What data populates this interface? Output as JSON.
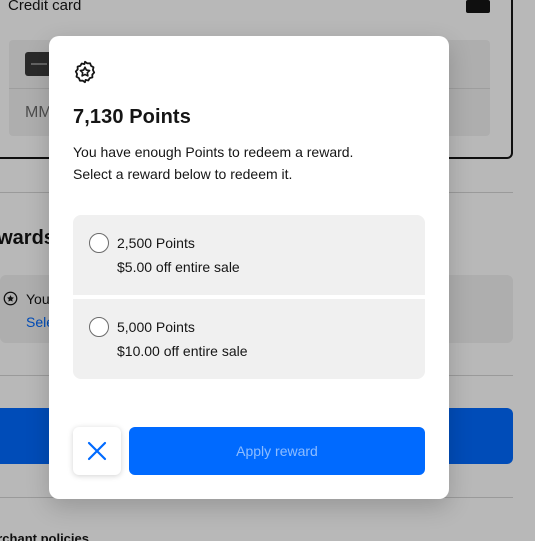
{
  "background": {
    "payment_label": "Credit card",
    "expiry_placeholder": "MM",
    "rewards_title": "ewards",
    "rewards_text": "You",
    "rewards_link": "Sele",
    "policies_text": "erchant policies"
  },
  "modal": {
    "icon": "star-badge-icon",
    "title": "7,130 Points",
    "description_lines": [
      "You have enough Points to redeem a reward.",
      "Select a reward below to redeem it."
    ],
    "options": [
      {
        "points": "2,500 Points",
        "description": "$5.00 off entire sale",
        "selected": false
      },
      {
        "points": "5,000 Points",
        "description": "$10.00 off entire sale",
        "selected": false
      }
    ],
    "close_icon": "close-icon",
    "apply_label": "Apply reward"
  },
  "colors": {
    "accent": "#006aff",
    "option_bg": "#f0f0f0",
    "text": "#151515"
  }
}
